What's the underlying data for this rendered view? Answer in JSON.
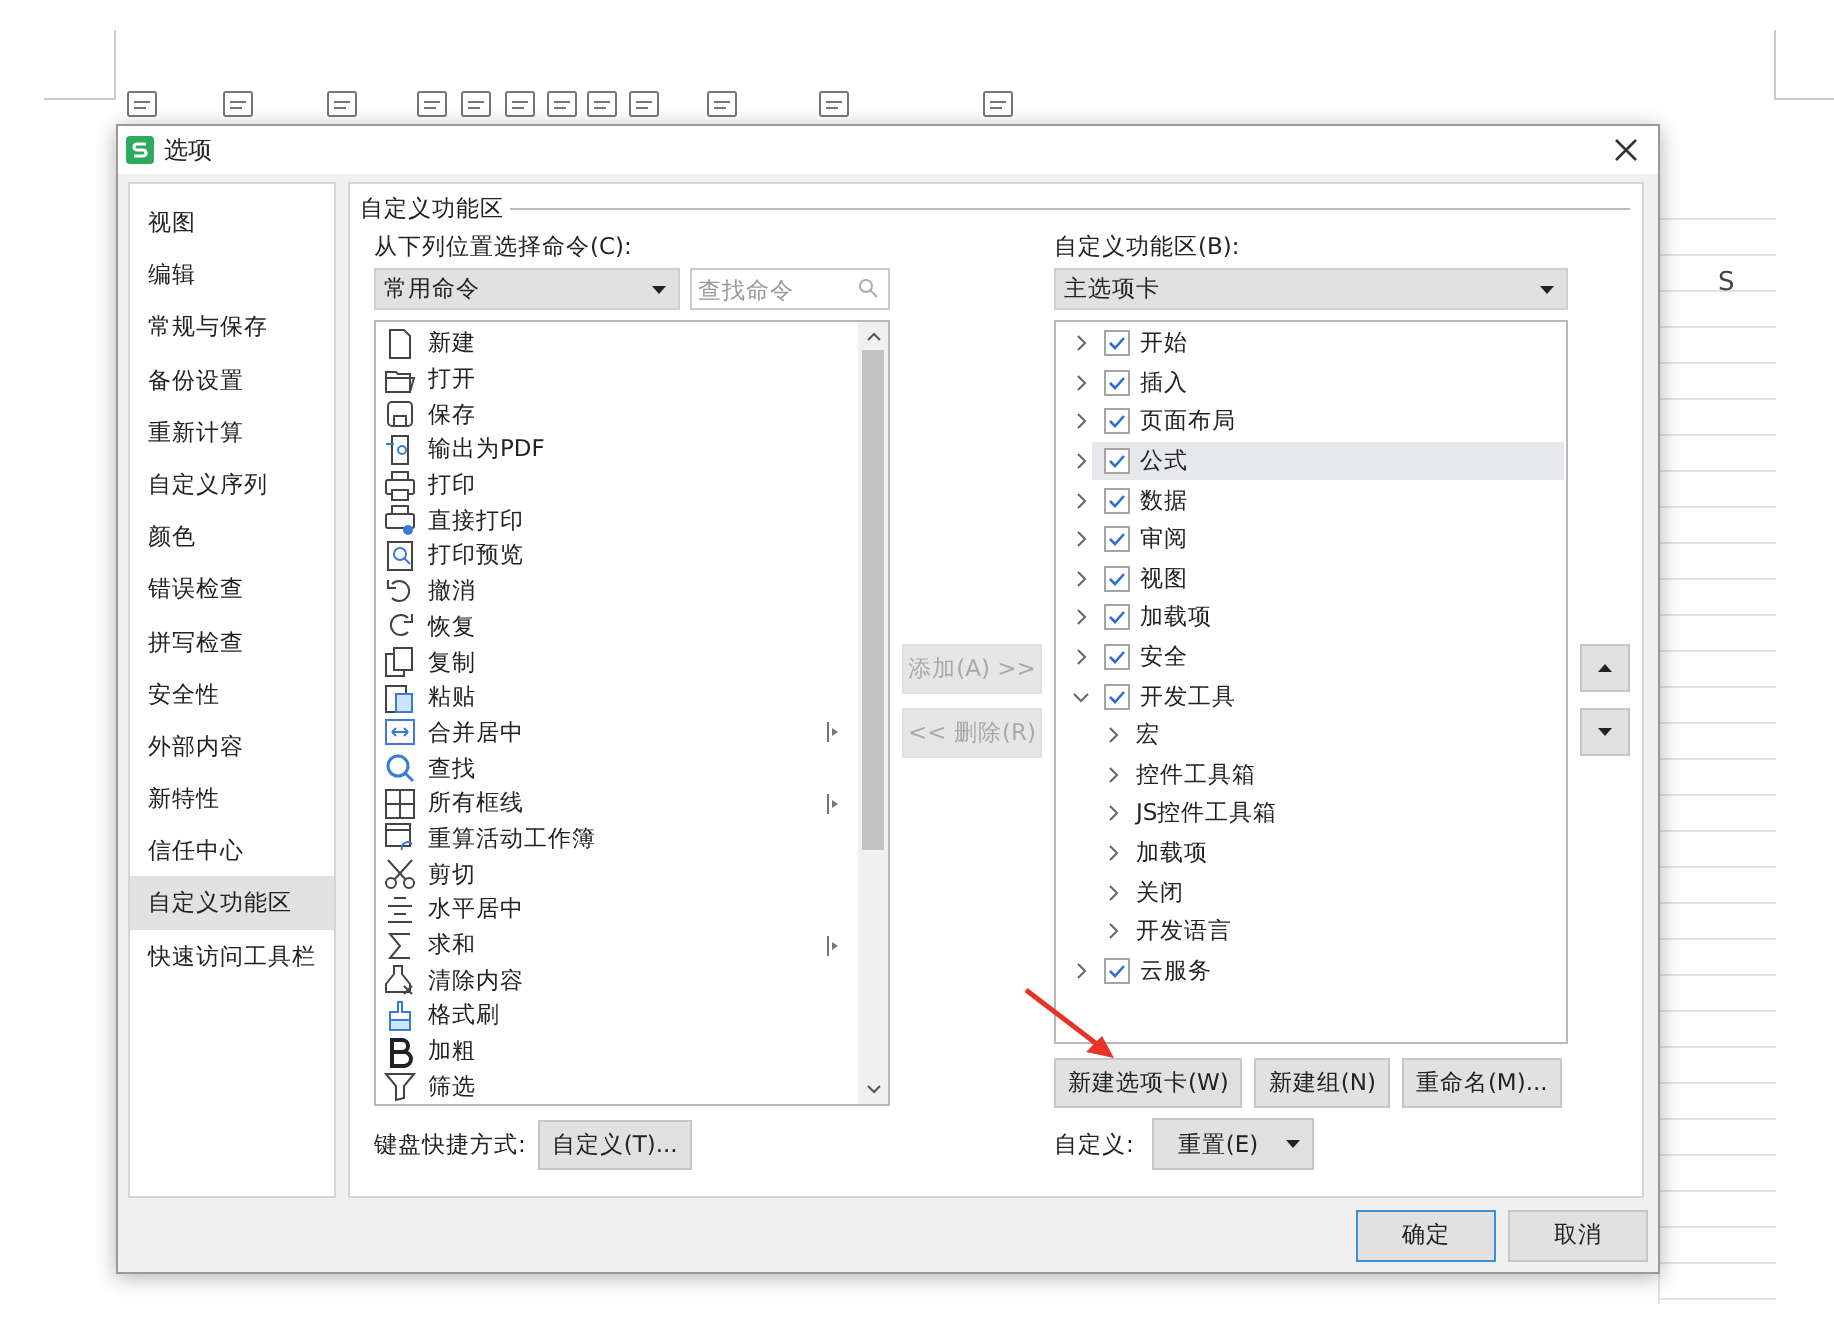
{
  "sheet": {
    "column_header": "S"
  },
  "window": {
    "title": "选项"
  },
  "sidebar": {
    "items": [
      {
        "label": "视图",
        "selected": false
      },
      {
        "label": "编辑",
        "selected": false
      },
      {
        "label": "常规与保存",
        "selected": false
      },
      {
        "label": "备份设置",
        "selected": false
      },
      {
        "label": "重新计算",
        "selected": false
      },
      {
        "label": "自定义序列",
        "selected": false
      },
      {
        "label": "颜色",
        "selected": false
      },
      {
        "label": "错误检查",
        "selected": false
      },
      {
        "label": "拼写检查",
        "selected": false
      },
      {
        "label": "安全性",
        "selected": false
      },
      {
        "label": "外部内容",
        "selected": false
      },
      {
        "label": "新特性",
        "selected": false
      },
      {
        "label": "信任中心",
        "selected": false
      },
      {
        "label": "自定义功能区",
        "selected": true
      },
      {
        "label": "快速访问工具栏",
        "selected": false
      }
    ]
  },
  "section_title": "自定义功能区",
  "commands": {
    "label": "从下列位置选择命令(C):",
    "dropdown": "常用命令",
    "search": {
      "placeholder": "查找命令"
    },
    "items": [
      {
        "label": "新建",
        "submenu": false
      },
      {
        "label": "打开",
        "submenu": false
      },
      {
        "label": "保存",
        "submenu": false
      },
      {
        "label": "输出为PDF",
        "submenu": false
      },
      {
        "label": "打印",
        "submenu": false
      },
      {
        "label": "直接打印",
        "submenu": false
      },
      {
        "label": "打印预览",
        "submenu": false
      },
      {
        "label": "撤消",
        "submenu": false
      },
      {
        "label": "恢复",
        "submenu": false
      },
      {
        "label": "复制",
        "submenu": false
      },
      {
        "label": "粘贴",
        "submenu": false
      },
      {
        "label": "合并居中",
        "submenu": true
      },
      {
        "label": "查找",
        "submenu": false
      },
      {
        "label": "所有框线",
        "submenu": true
      },
      {
        "label": "重算活动工作簿",
        "submenu": false
      },
      {
        "label": "剪切",
        "submenu": false
      },
      {
        "label": "水平居中",
        "submenu": false
      },
      {
        "label": "求和",
        "submenu": true
      },
      {
        "label": "清除内容",
        "submenu": false
      },
      {
        "label": "格式刷",
        "submenu": false
      },
      {
        "label": "加粗",
        "submenu": false
      },
      {
        "label": "筛选",
        "submenu": false
      }
    ]
  },
  "keyboard": {
    "label": "键盘快捷方式:",
    "button": "自定义(T)..."
  },
  "transfer_buttons": [
    {
      "label": "添加(A) >>",
      "disabled": true
    },
    {
      "label": "<< 删除(R)",
      "disabled": true
    }
  ],
  "ribbon": {
    "label": "自定义功能区(B):",
    "dropdown": "主选项卡",
    "tree": [
      {
        "label": "开始",
        "kind": "tab",
        "checked": true,
        "expanded": false,
        "selected": false
      },
      {
        "label": "插入",
        "kind": "tab",
        "checked": true,
        "expanded": false,
        "selected": false
      },
      {
        "label": "页面布局",
        "kind": "tab",
        "checked": true,
        "expanded": false,
        "selected": false
      },
      {
        "label": "公式",
        "kind": "tab",
        "checked": true,
        "expanded": false,
        "selected": true
      },
      {
        "label": "数据",
        "kind": "tab",
        "checked": true,
        "expanded": false,
        "selected": false
      },
      {
        "label": "审阅",
        "kind": "tab",
        "checked": true,
        "expanded": false,
        "selected": false
      },
      {
        "label": "视图",
        "kind": "tab",
        "checked": true,
        "expanded": false,
        "selected": false
      },
      {
        "label": "加载项",
        "kind": "tab",
        "checked": true,
        "expanded": false,
        "selected": false
      },
      {
        "label": "安全",
        "kind": "tab",
        "checked": true,
        "expanded": false,
        "selected": false
      },
      {
        "label": "开发工具",
        "kind": "tab",
        "checked": true,
        "expanded": true,
        "selected": false,
        "children": [
          {
            "label": "宏",
            "kind": "group",
            "expanded": false,
            "selected": false
          },
          {
            "label": "控件工具箱",
            "kind": "group",
            "expanded": false,
            "selected": false
          },
          {
            "label": "JS控件工具箱",
            "kind": "group",
            "expanded": false,
            "selected": false
          },
          {
            "label": "加载项",
            "kind": "group",
            "expanded": false,
            "selected": false
          },
          {
            "label": "关闭",
            "kind": "group",
            "expanded": false,
            "selected": false
          },
          {
            "label": "开发语言",
            "kind": "group",
            "expanded": false,
            "selected": false
          }
        ]
      },
      {
        "label": "云服务",
        "kind": "tab",
        "checked": true,
        "expanded": false,
        "selected": false
      }
    ],
    "buttons": [
      "新建选项卡(W)",
      "新建组(N)",
      "重命名(M)..."
    ],
    "reset_label": "自定义:",
    "reset_button": "重置(E)"
  },
  "footer_buttons": [
    {
      "label": "确定",
      "default": true
    },
    {
      "label": "取消",
      "default": false
    }
  ]
}
